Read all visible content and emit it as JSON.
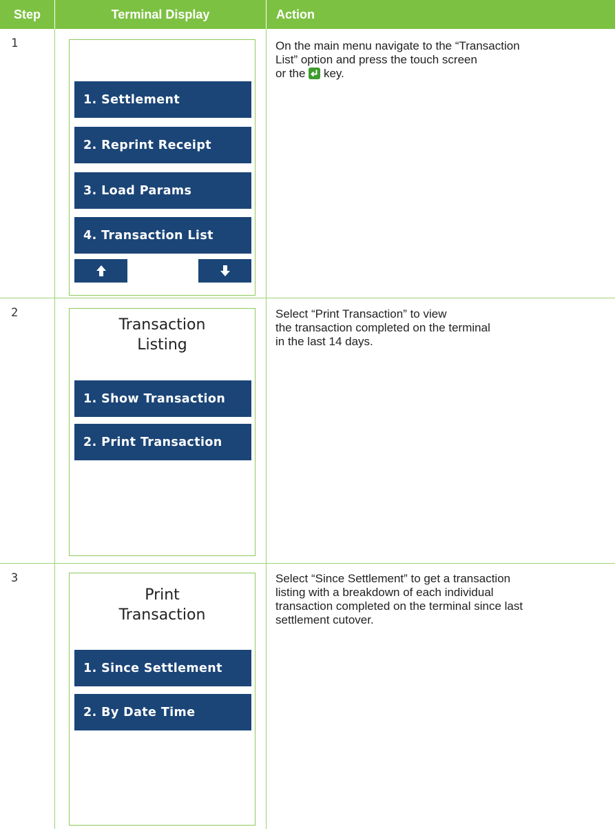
{
  "header": {
    "step": "Step",
    "terminal_display": "Terminal Display",
    "action": "Action"
  },
  "rows": [
    {
      "step": "1",
      "buttons": [
        "1. Settlement",
        "2. Reprint Receipt",
        "3. Load Params",
        "4. Transaction List"
      ],
      "action_line1": "On the main menu navigate to the “Transaction",
      "action_line2": "List” option and press the touch screen",
      "action_pre": "or the",
      "action_post": "key."
    },
    {
      "step": "2",
      "title": "Transaction\nListing",
      "buttons": [
        "1. Show Transaction",
        "2. Print Transaction"
      ],
      "action": "Select “Print Transaction” to view\nthe transaction completed on the terminal\nin the last 14 days."
    },
    {
      "step": "3",
      "title": "Print\nTransaction",
      "buttons": [
        "1. Since Settlement",
        "2. By Date Time"
      ],
      "action": "Select “Since Settlement” to get a transaction\nlisting with a breakdown of each individual\ntransaction completed on the terminal since last\nsettlement cutover."
    }
  ],
  "icons": {
    "up": "arrow-up-icon",
    "down": "arrow-down-icon",
    "enter_key": "enter-key-icon"
  },
  "colors": {
    "header_green": "#7dc142",
    "button_navy": "#1b4577",
    "enter_key_green": "#3f9c2e"
  }
}
